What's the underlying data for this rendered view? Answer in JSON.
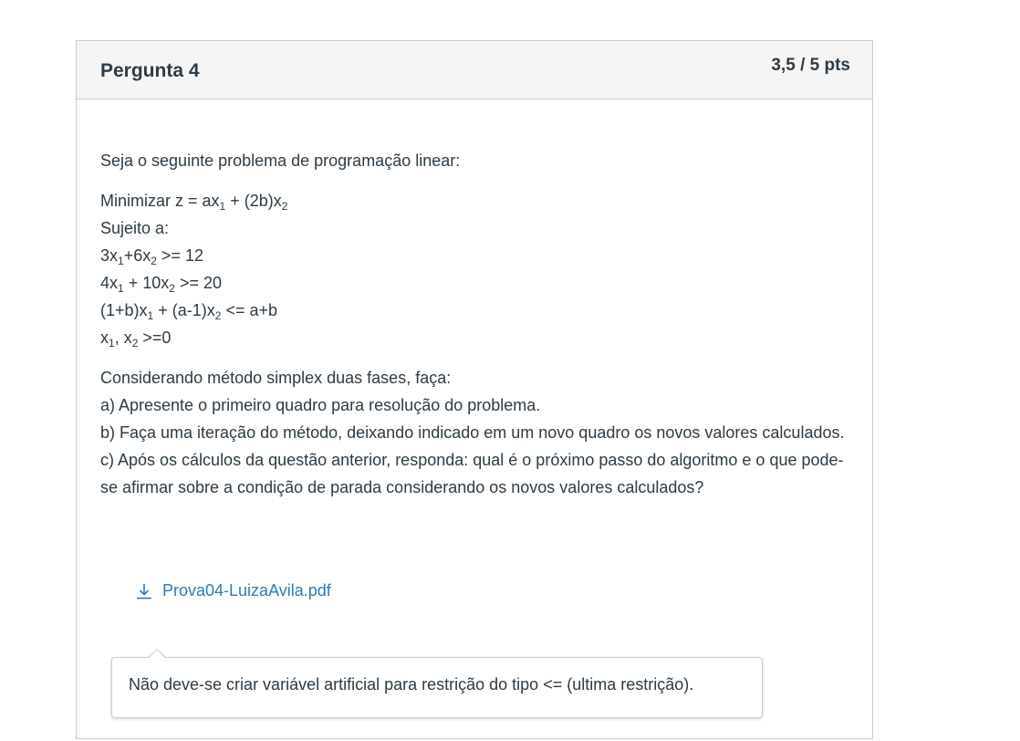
{
  "question": {
    "title": "Pergunta 4",
    "points": "3,5 / 5 pts",
    "intro": "Seja o seguinte problema de programação linear:",
    "objective": {
      "prefix": "Minimizar z = ax",
      "s1": "1",
      "mid": " + (2b)x",
      "s2": "2"
    },
    "subject_to": "Sujeito a:",
    "c1": {
      "a": "3x",
      "s1": "1",
      "b": "+6x",
      "s2": "2",
      "c": " >= 12"
    },
    "c2": {
      "a": "4x",
      "s1": "1",
      "b": " + 10x",
      "s2": "2",
      "c": " >= 20"
    },
    "c3": {
      "a": "(1+b)x",
      "s1": "1",
      "b": " + (a-1)x",
      "s2": "2",
      "c": " <= a+b"
    },
    "c4": {
      "a": "x",
      "s1": "1",
      "b": ", x",
      "s2": "2",
      "c": " >=0"
    },
    "instructions": {
      "lead": "Considerando método simplex duas fases, faça:",
      "a": "a) Apresente o primeiro quadro para resolução do problema.",
      "b": "b) Faça uma iteração do método, deixando indicado em um novo quadro os novos valores calculados.",
      "c": "c) Após os cálculos da questão anterior, responda: qual é o próximo passo do algoritmo e o que pode-se afirmar sobre a condição de parada considerando os novos valores calculados?"
    }
  },
  "attachment": {
    "filename": "Prova04-LuizaAvila.pdf",
    "icon": "download-icon"
  },
  "comment": {
    "text": "Não deve-se criar variável artificial para restrição do tipo <= (ultima restrição)."
  },
  "colors": {
    "link": "#2b7abc",
    "text": "#2d3b45",
    "border": "#c7cdd1",
    "header_bg": "#f5f5f5"
  }
}
